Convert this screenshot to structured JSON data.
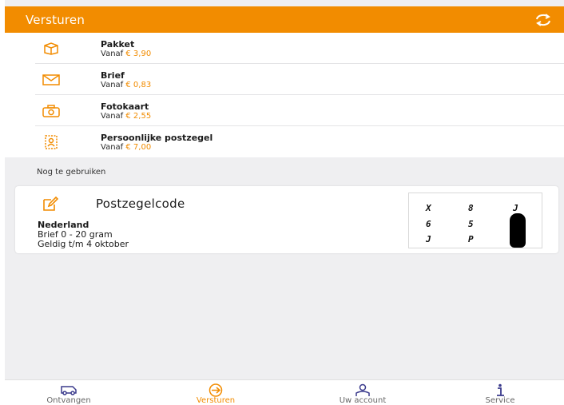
{
  "colors": {
    "accent": "#f28c00",
    "background": "#efeff1"
  },
  "header": {
    "title": "Versturen",
    "refresh_icon": "refresh-icon"
  },
  "products": [
    {
      "title": "Pakket",
      "prefix": "Vanaf",
      "price": "€ 3,90",
      "icon": "package-icon"
    },
    {
      "title": "Brief",
      "prefix": "Vanaf",
      "price": "€ 0,83",
      "icon": "envelope-icon"
    },
    {
      "title": "Fotokaart",
      "prefix": "Vanaf",
      "price": "€ 2,55",
      "icon": "camera-icon"
    },
    {
      "title": "Persoonlijke postzegel",
      "prefix": "Vanaf",
      "price": "€ 7,00",
      "icon": "personal-stamp-icon"
    }
  ],
  "section": {
    "label": "Nog te gebruiken"
  },
  "stamp": {
    "title": "Postzegelcode",
    "country": "Nederland",
    "type": "Brief 0 - 20 gram",
    "valid": "Geldig t/m 4 oktober",
    "code": [
      "X",
      "8",
      "J",
      "6",
      "5",
      "J",
      "P"
    ]
  },
  "tabs": [
    {
      "label": "Ontvangen",
      "icon": "van-icon",
      "active": false
    },
    {
      "label": "Versturen",
      "icon": "send-arrow-icon",
      "active": true
    },
    {
      "label": "Uw account",
      "icon": "account-icon",
      "active": false
    },
    {
      "label": "Service",
      "icon": "info-icon",
      "active": false
    }
  ]
}
